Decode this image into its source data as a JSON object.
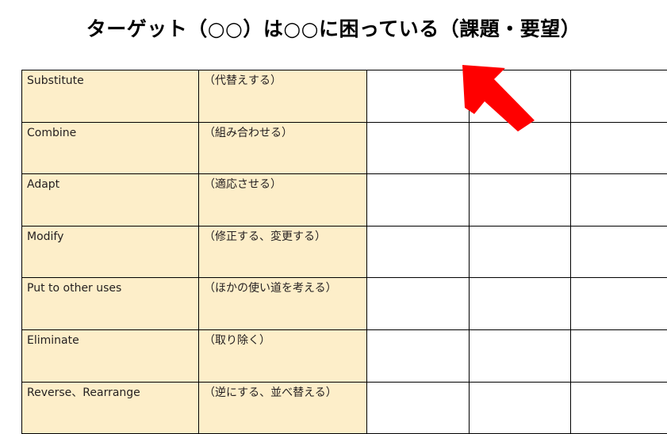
{
  "slide": {
    "title": "ターゲット（○○）は○○に困っている（課題・要望）",
    "background_color": "#ffffff"
  },
  "colors": {
    "label_cell_fill": "#fdeec9",
    "blank_cell_fill": "#ffffff",
    "border": "#000000",
    "text": "#231f20",
    "arrow_fill": "#ff0000"
  },
  "table": {
    "columns": [
      {
        "key": "term",
        "header": ""
      },
      {
        "key": "meaning",
        "header": ""
      },
      {
        "key": "blank1",
        "header": ""
      },
      {
        "key": "blank2",
        "header": ""
      },
      {
        "key": "blank3",
        "header": ""
      }
    ],
    "rows": [
      {
        "term": "Substitute",
        "meaning": "（代替えする）",
        "blank1": "",
        "blank2": "",
        "blank3": ""
      },
      {
        "term": "Combine",
        "meaning": "（組み合わせる）",
        "blank1": "",
        "blank2": "",
        "blank3": ""
      },
      {
        "term": "Adapt",
        "meaning": "（適応させる）",
        "blank1": "",
        "blank2": "",
        "blank3": ""
      },
      {
        "term": "Modify",
        "meaning": "（修正する、変更する）",
        "blank1": "",
        "blank2": "",
        "blank3": ""
      },
      {
        "term": "Put to other uses",
        "meaning": "（ほかの使い道を考える）",
        "blank1": "",
        "blank2": "",
        "blank3": ""
      },
      {
        "term": "Eliminate",
        "meaning": "（取り除く）",
        "blank1": "",
        "blank2": "",
        "blank3": ""
      },
      {
        "term": "Reverse、Rearrange",
        "meaning": "（逆にする、並べ替える）",
        "blank1": "",
        "blank2": "",
        "blank3": ""
      }
    ]
  },
  "annotation": {
    "arrow": {
      "name": "red-arrow-up-left",
      "color": "#ff0000",
      "direction": "up-left"
    }
  }
}
